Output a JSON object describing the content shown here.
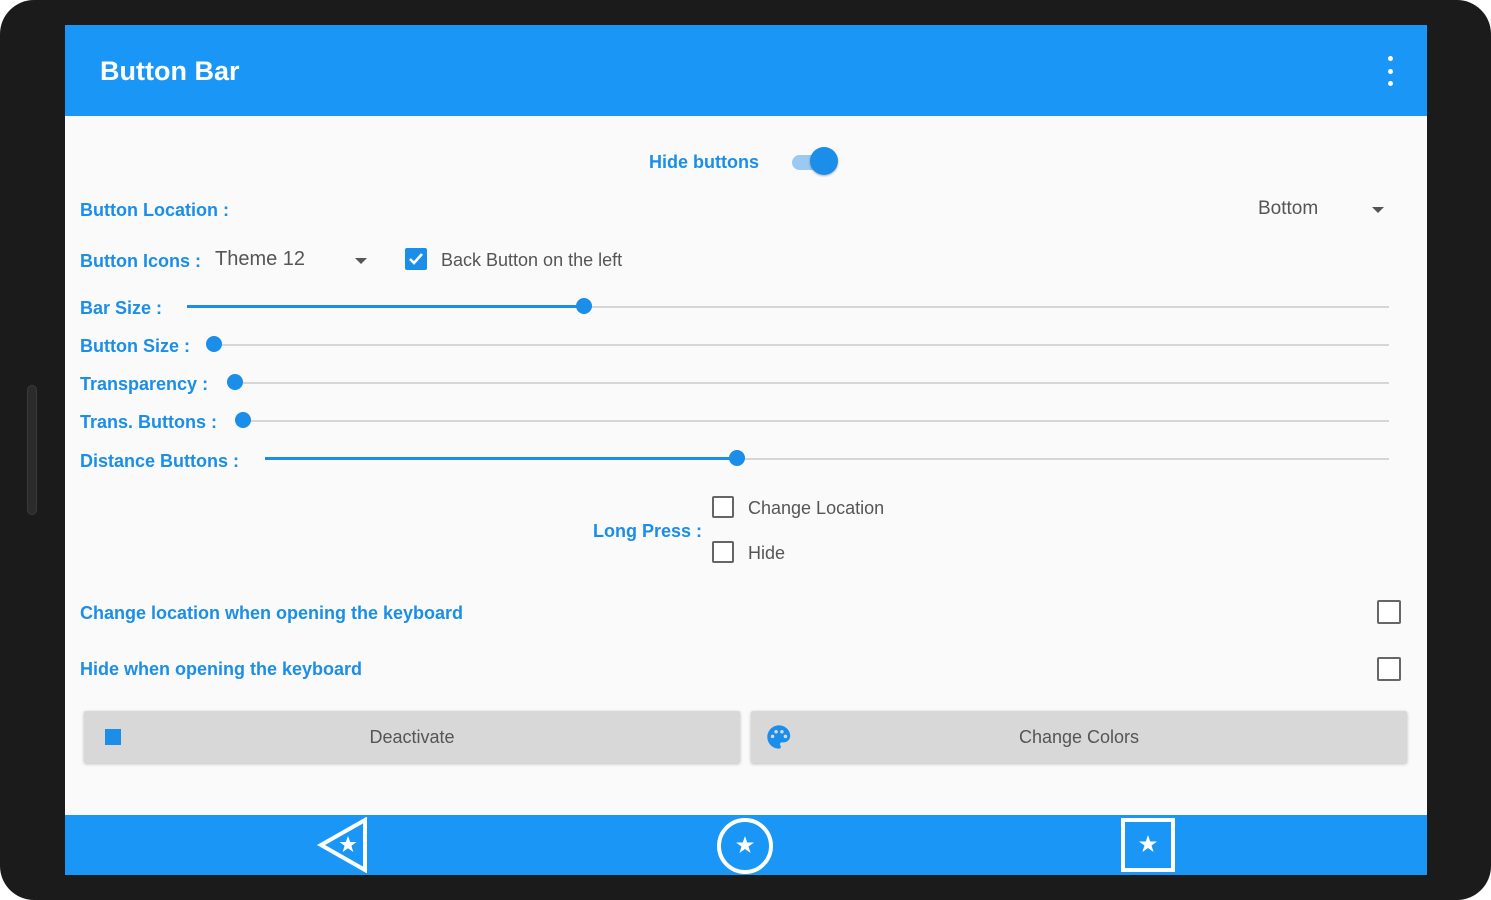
{
  "appbar": {
    "title": "Button Bar",
    "menu_icon": "more-vert-icon"
  },
  "hide_buttons": {
    "label": "Hide buttons",
    "enabled": true
  },
  "button_location": {
    "label": "Button Location :",
    "value": "Bottom"
  },
  "button_icons": {
    "label": "Button Icons :",
    "value": "Theme 12"
  },
  "back_button_left": {
    "label": "Back Button on the left",
    "checked": true
  },
  "sliders": {
    "bar_size": {
      "label": "Bar Size :",
      "value": 0.33
    },
    "button_size": {
      "label": "Button Size :",
      "value": 0.0
    },
    "transparency": {
      "label": "Transparency :",
      "value": 0.0
    },
    "trans_buttons": {
      "label": "Trans. Buttons :",
      "value": 0.0
    },
    "distance_buttons": {
      "label": "Distance Buttons :",
      "value": 0.42
    }
  },
  "long_press": {
    "label": "Long Press :",
    "change_location": {
      "label": "Change Location",
      "checked": false
    },
    "hide": {
      "label": "Hide",
      "checked": false
    }
  },
  "keyboard": {
    "change_location": {
      "label": "Change location when opening the keyboard",
      "checked": false
    },
    "hide": {
      "label": "Hide when opening the keyboard",
      "checked": false
    }
  },
  "buttons": {
    "deactivate": {
      "label": "Deactivate",
      "icon": "stop-square-icon"
    },
    "change_colors": {
      "label": "Change Colors",
      "icon": "palette-icon"
    }
  },
  "navbar": {
    "back_icon": "back-star-icon",
    "home_icon": "home-star-icon",
    "recent_icon": "recent-star-icon"
  },
  "colors": {
    "accent": "#1a97f6",
    "label": "#1a8ee8"
  }
}
